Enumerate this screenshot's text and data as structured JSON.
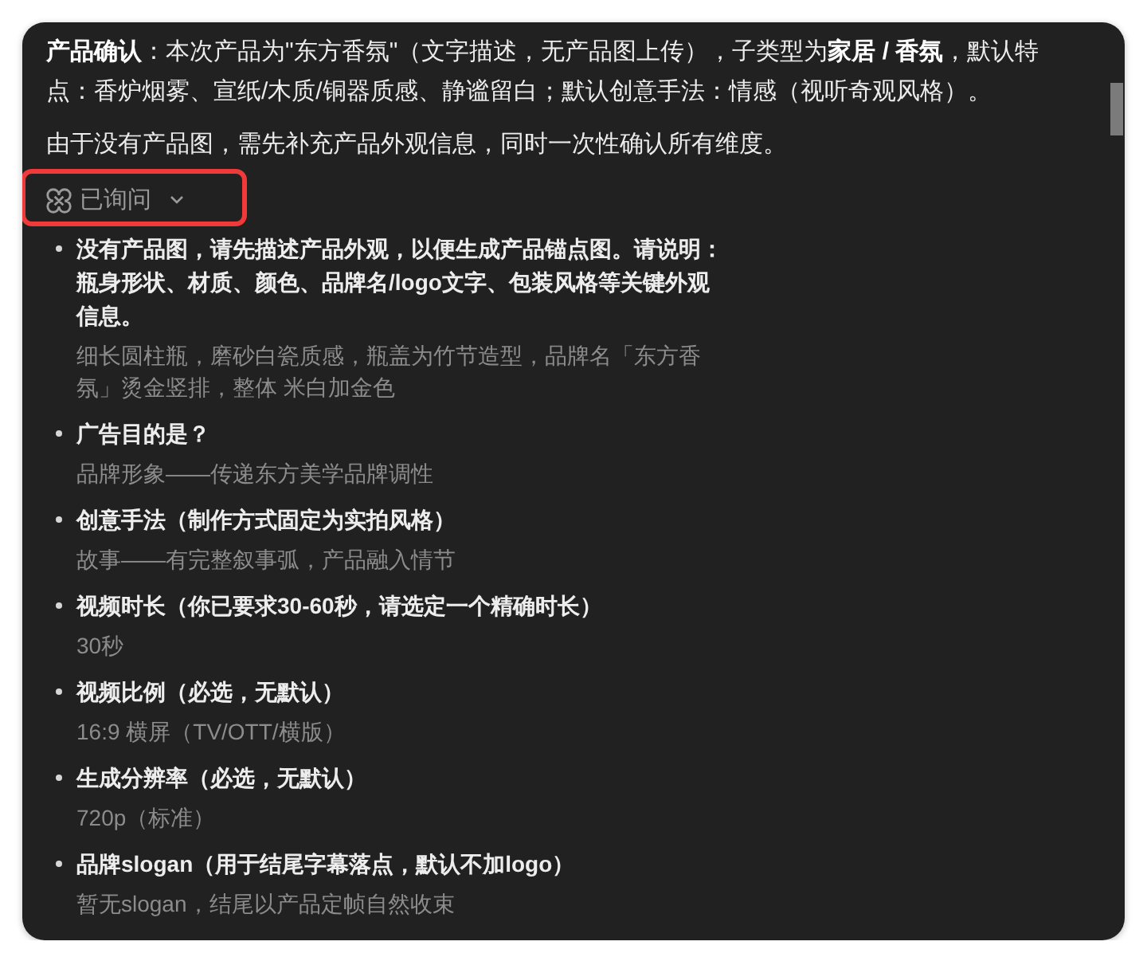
{
  "message": {
    "paragraphs": [
      "**产品确认**：本次产品为\"东方香氛\"（文字描述，无产品图上传），子类型为**家居 / 香氛**，默认特点：香炉烟雾、宣纸/木质/铜器质感、静谧留白；默认创意手法：情感（视听奇观风格）。",
      "由于没有产品图，需先补充产品外观信息，同时一次性确认所有维度。"
    ]
  },
  "asked_toggle": {
    "label": "已询问",
    "highlighted": true
  },
  "questions": [
    {
      "question": "没有产品图，请先描述产品外观，以便生成产品锚点图。请说明：瓶身形状、材质、颜色、品牌名/logo文字、包装风格等关键外观信息。",
      "answer": "细长圆柱瓶，磨砂白瓷质感，瓶盖为竹节造型，品牌名「东方香氛」烫金竖排，整体 米白加金色"
    },
    {
      "question": "广告目的是？",
      "answer": "品牌形象——传递东方美学品牌调性"
    },
    {
      "question": "创意手法（制作方式固定为实拍风格）",
      "answer": "故事——有完整叙事弧，产品融入情节"
    },
    {
      "question": "视频时长（你已要求30-60秒，请选定一个精确时长）",
      "answer": "30秒"
    },
    {
      "question": "视频比例（必选，无默认）",
      "answer": "16:9 横屏（TV/OTT/横版）"
    },
    {
      "question": "生成分辨率（必选，无默认）",
      "answer": "720p（标准）"
    },
    {
      "question": "品牌slogan（用于结尾字幕落点，默认不加logo）",
      "answer": "暂无slogan，结尾以产品定帧自然收束"
    }
  ]
}
